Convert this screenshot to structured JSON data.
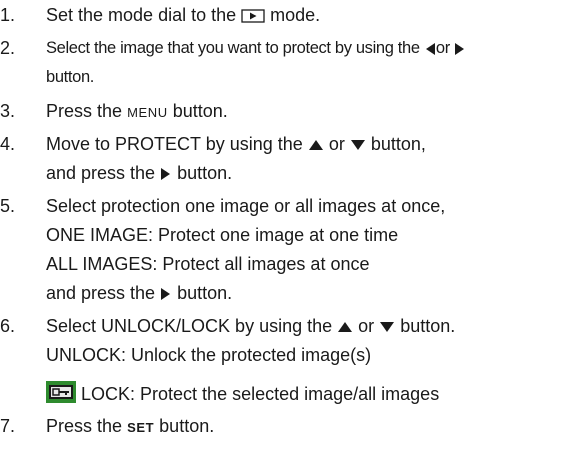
{
  "steps": [
    {
      "number": "1.",
      "before": "Set the mode dial to the",
      "after": "mode.",
      "icon": "playback-icon"
    },
    {
      "number": "2.",
      "before": "Select the image that you want to protect by using the",
      "between": "or",
      "after": "",
      "continuation": "button.",
      "icons": [
        "left-arrow-icon",
        "right-arrow-icon"
      ]
    },
    {
      "number": "3.",
      "before": "Press the",
      "key": "MENU",
      "after": "button."
    },
    {
      "number": "4.",
      "before": "Move to PROTECT by using the",
      "between": "or",
      "after": "button,",
      "continuation_before": "and press the",
      "continuation_after": "button.",
      "icons": [
        "up-arrow-icon",
        "down-arrow-icon",
        "right-arrow-icon"
      ]
    },
    {
      "number": "5.",
      "text": "Select protection one image or all images at once,",
      "lines": [
        "ONE IMAGE: Protect one image at one time",
        "ALL IMAGES: Protect all images at once"
      ],
      "continuation_before": "and press the",
      "continuation_after": "button.",
      "icons": [
        "right-arrow-icon"
      ]
    },
    {
      "number": "6.",
      "before": "Select UNLOCK/LOCK by using the",
      "between": "or",
      "after": "button.",
      "line_unlock": "UNLOCK: Unlock the protected image(s)",
      "line_lock": "LOCK: Protect the selected image/all images",
      "icons": [
        "up-arrow-icon",
        "down-arrow-icon",
        "lock-key-icon"
      ]
    },
    {
      "number": "7.",
      "before": "Press the",
      "key": "SET",
      "after": "button."
    }
  ],
  "colors": {
    "text": "#1a1a1a",
    "lock_icon_bg": "#2e8b2e",
    "lock_icon_inner": "#e8e8e8"
  }
}
